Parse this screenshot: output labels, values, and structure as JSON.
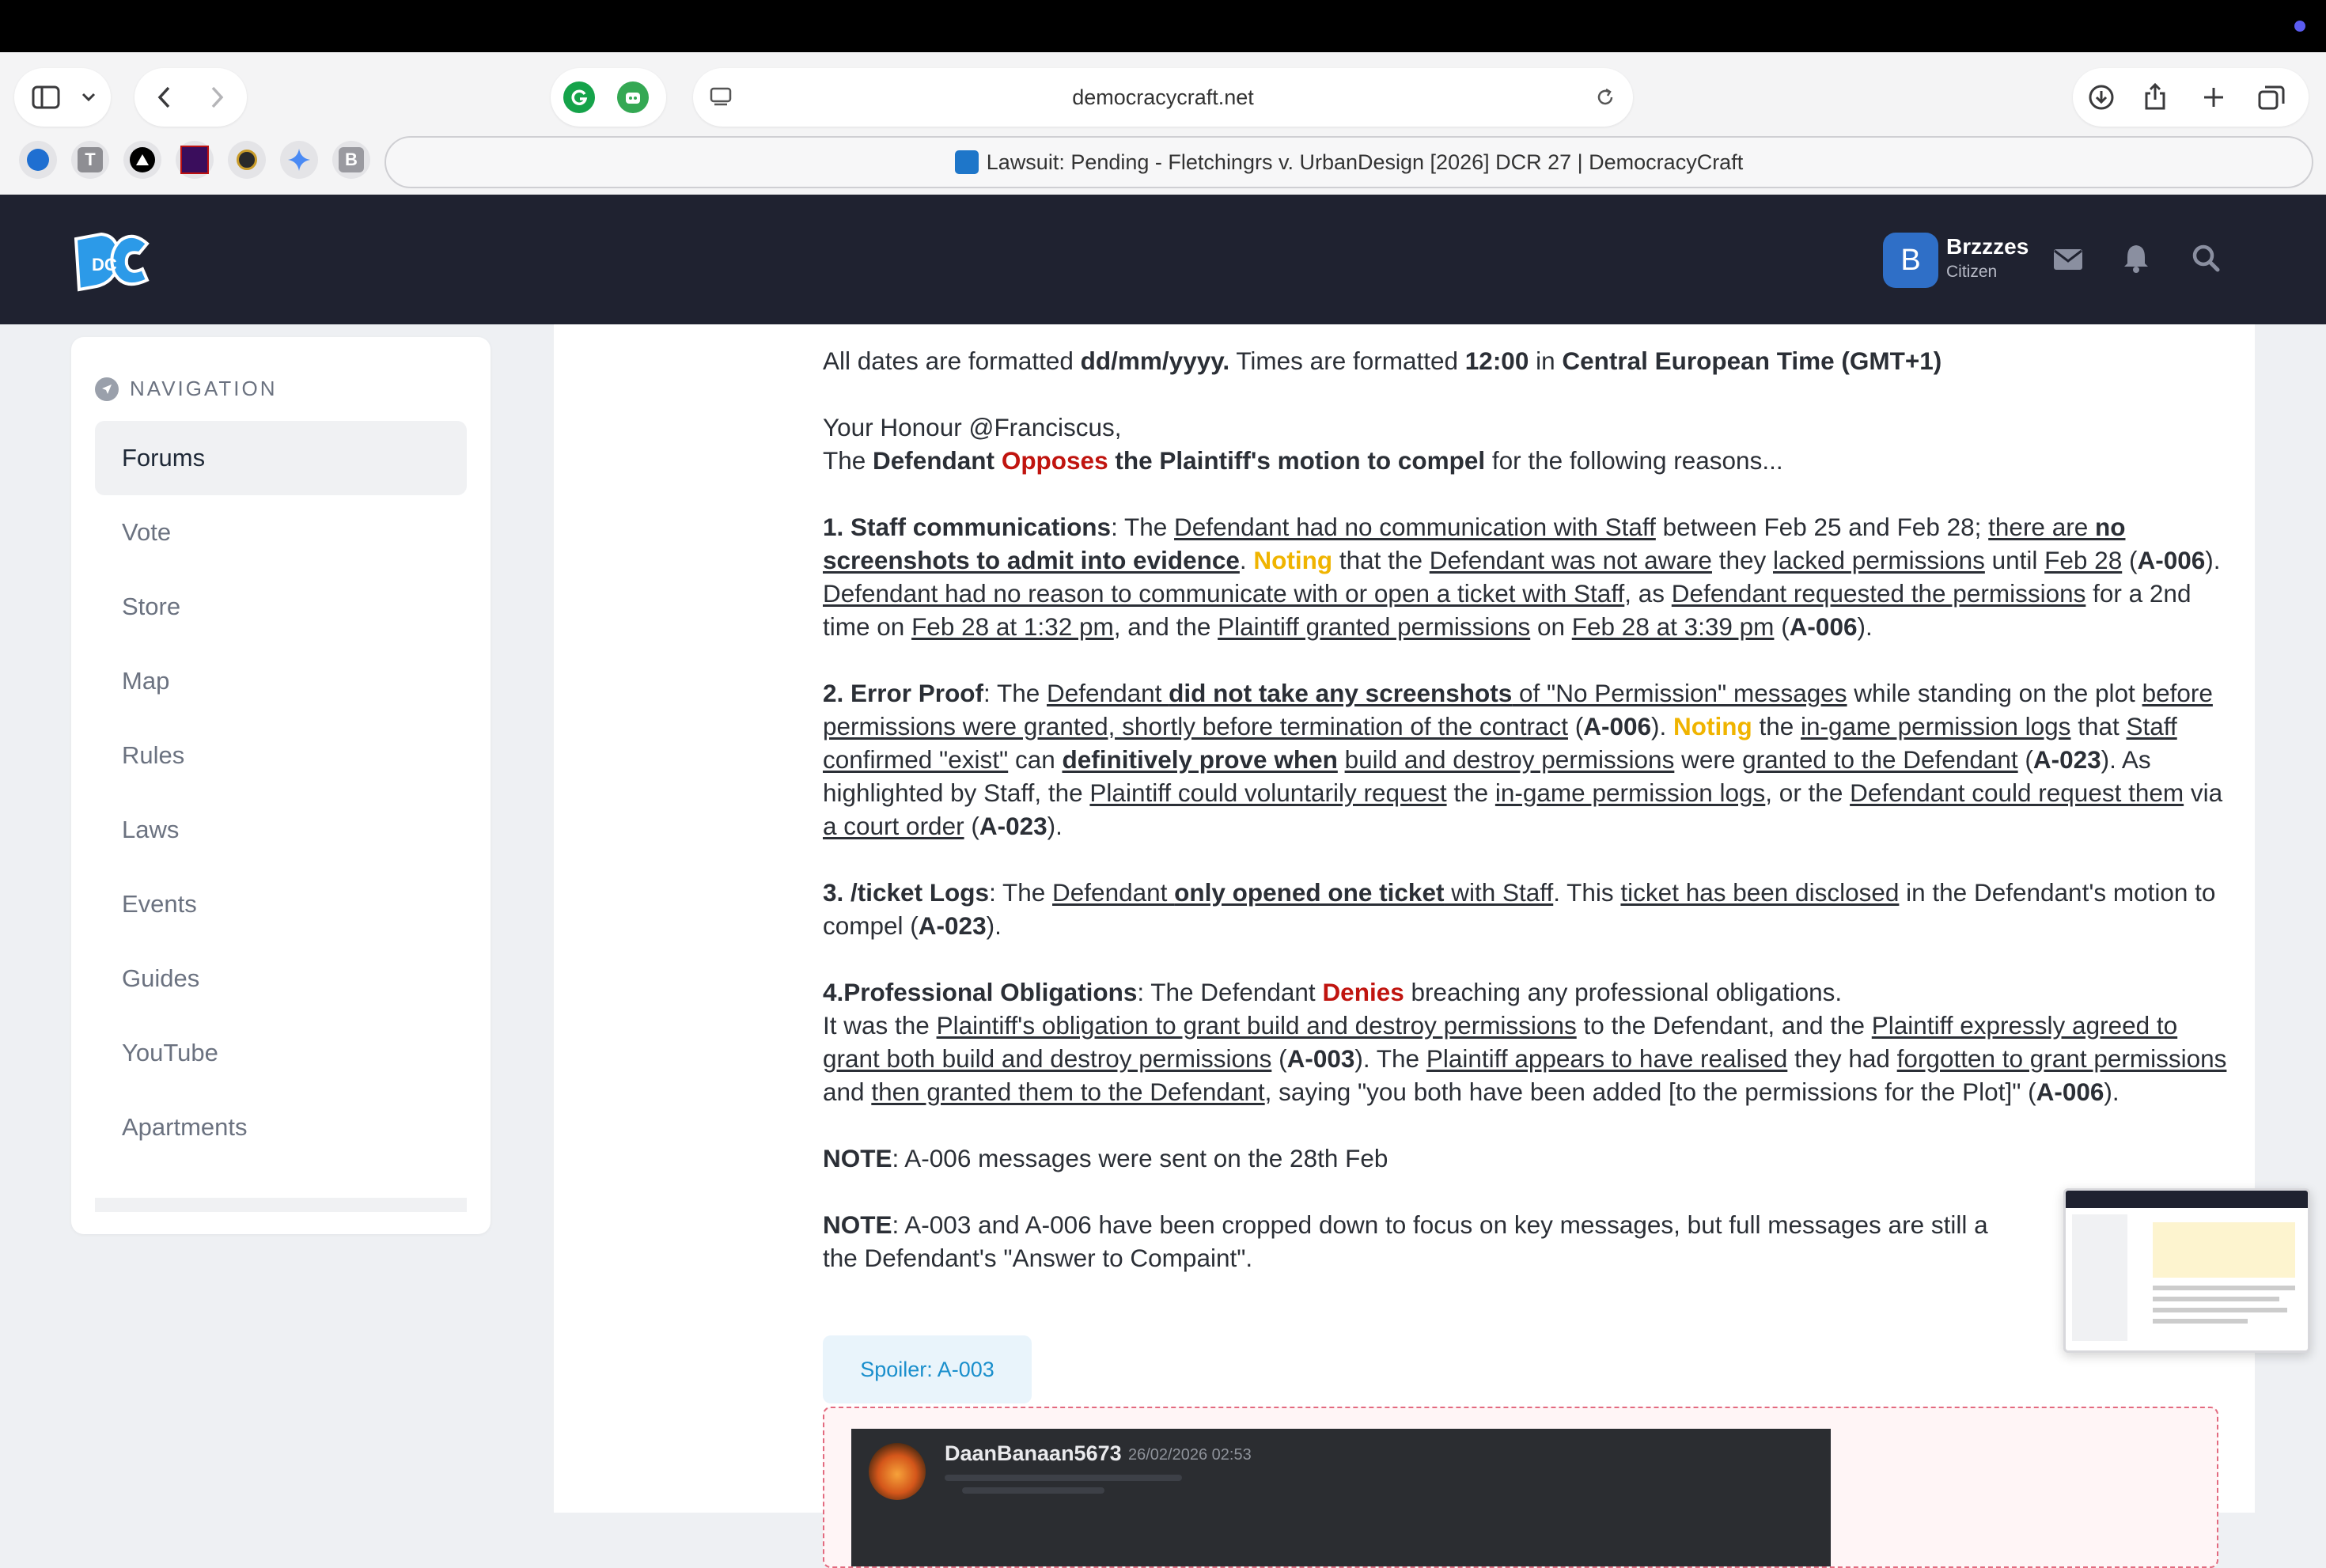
{
  "browser": {
    "url": "democracycraft.net",
    "tab_title": "Lawsuit: Pending - Fletchingrs v. UrbanDesign [2026] DCR 27 | DemocracyCraft",
    "favorites": [
      "T",
      "B"
    ]
  },
  "header": {
    "logo_text": "DC",
    "user": {
      "initial": "B",
      "name": "Brzzzes",
      "role": "Citizen"
    }
  },
  "sidebar": {
    "heading": "NAVIGATION",
    "items": [
      "Forums",
      "Vote",
      "Store",
      "Map",
      "Rules",
      "Laws",
      "Events",
      "Guides",
      "YouTube",
      "Apartments"
    ]
  },
  "post": {
    "dates": {
      "a": "All dates are formatted ",
      "b": "dd/mm/yyyy.",
      "c": " Times are formatted ",
      "d": "12:00",
      "e": " in ",
      "f": "Central European Time (GMT+1)"
    },
    "greeting": {
      "a": "Your Honour ",
      "b": "@Franciscus",
      "c": ","
    },
    "intro": {
      "a": "The ",
      "b": "Defendant",
      "c": " ",
      "d": "Opposes",
      "e": " ",
      "f": "the Plaintiff's motion to compel",
      "g": " for the following reasons..."
    },
    "p1": {
      "s1": "1. Staff communications",
      "s2": ": The ",
      "s3": "Defendant had no communication with Staff",
      "s4": " between Feb 25 and Feb 28; ",
      "s5": "there are ",
      "s6": "no screenshots to admit into evidence",
      "s7": ". ",
      "s8": "Noting",
      "s9": " that the ",
      "s10": "Defendant was not aware",
      "s11": " they ",
      "s12": "lacked permissions",
      "s13": " until ",
      "s14": "Feb 28",
      "s15": " (",
      "s16": "A-006",
      "s17": "). ",
      "s18": "Defendant had no reason to communicate with or open a ticket with Staff",
      "s19": ", as ",
      "s20": "Defendant requested the permissions",
      "s21": " for a 2nd time on ",
      "s22": "Feb 28 at 1:32 pm",
      "s23": ", and the ",
      "s24": "Plaintiff granted permissions",
      "s25": " on ",
      "s26": "Feb 28 at 3:39 pm",
      "s27": " (",
      "s28": "A-006",
      "s29": ")."
    },
    "p2": {
      "s1": "2. Error Proof",
      "s2": ": The ",
      "s3": "Defendant ",
      "s4": "did not take any screenshots",
      "s5": " of \"No Permission\" messages",
      "s6": " while standing on the plot ",
      "s7": "before permissions were granted, shortly before termination of the contract",
      "s8": " (",
      "s9": "A-006",
      "s10": "). ",
      "s11": "Noting",
      "s12": " the ",
      "s13": "in-game permission logs",
      "s14": " that ",
      "s15": "Staff confirmed \"exist\"",
      "s16": " can ",
      "s17": "definitively prove when",
      "s18": " ",
      "s19": "build and destroy permissions",
      "s20": " were ",
      "s21": "granted to the Defendant",
      "s22": " (",
      "s23": "A-023",
      "s24": "). As highlighted by Staff, the ",
      "s25": "Plaintiff could voluntarily request",
      "s26": " the ",
      "s27": "in-game permission logs",
      "s28": ", or the ",
      "s29": "Defendant could request them",
      "s30": " via ",
      "s31": "a court order",
      "s32": " (",
      "s33": "A-023",
      "s34": ")."
    },
    "p3": {
      "s1": "3. /ticket Logs",
      "s2": ": The ",
      "s3": "Defendant ",
      "s4": "only opened one ticket",
      "s5": " with Staff",
      "s6": ". This ",
      "s7": "ticket has been disclosed",
      "s8": " in the Defendant's motion to compel (",
      "s9": "A-023",
      "s10": ")."
    },
    "p4": {
      "s1": "4.Professional Obligations",
      "s2": ": The Defendant ",
      "s3": "Denies",
      "s4": " breaching any professional obligations.",
      "s5": "It was the ",
      "s6": "Plaintiff's obligation to grant build and destroy permissions",
      "s7": " to the Defendant, and the ",
      "s8": "Plaintiff expressly agreed to grant both build and destroy permissions",
      "s9": " (",
      "s10": "A-003",
      "s11": "). The ",
      "s12": "Plaintiff appears to have realised",
      "s13": " they had ",
      "s14": "forgotten to grant permissions",
      "s15": " and ",
      "s16": "then granted them to the Defendant",
      "s17": ", saying \"you both have been added [to the permissions for the Plot]\" (",
      "s18": "A-006",
      "s19": ")."
    },
    "note1": {
      "a": "NOTE",
      "b": ": A-006 messages were sent on the 28th Feb"
    },
    "note2": {
      "a": "NOTE",
      "b": ": A-003 and A-006 have been cropped down to focus on key messages, but full messages are still a",
      "c": "the Defendant's \"Answer to Compaint\"."
    },
    "spoiler_label": "Spoiler: A-003",
    "embed": {
      "author": "DaanBanaan5673",
      "timestamp": "26/02/2026 02:53"
    }
  },
  "colors": {
    "accent_red": "#c0140f",
    "accent_yellow": "#f0b400",
    "header_bg": "#1f2230",
    "spoiler_blue": "#1a8fcc"
  }
}
